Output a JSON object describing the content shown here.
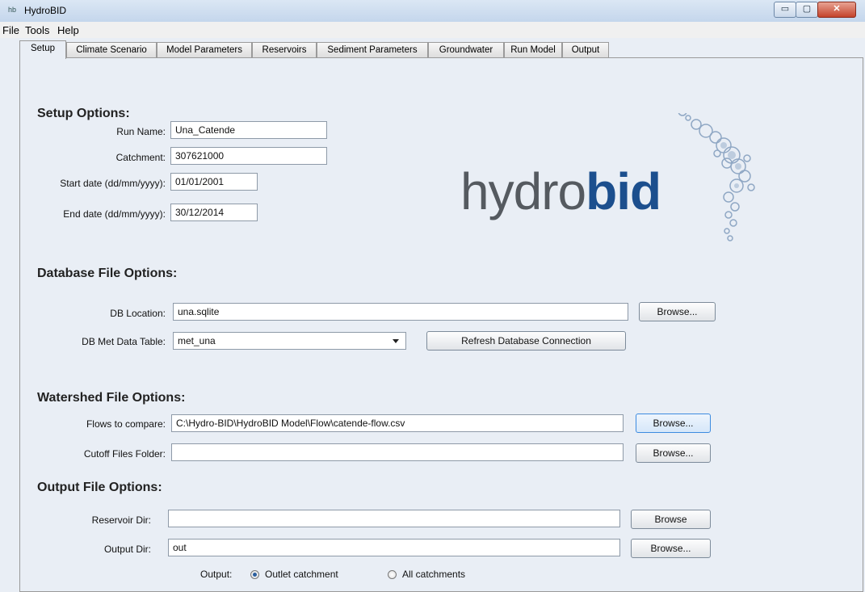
{
  "window": {
    "app_icon": "hb",
    "title": "HydroBID",
    "minimize": "▭",
    "maximize": "▢",
    "close": "✕"
  },
  "menu": [
    "File",
    "Tools",
    "Help"
  ],
  "tabs": [
    "Setup",
    "Climate Scenario",
    "Model Parameters",
    "Reservoirs",
    "Sediment Parameters",
    "Groundwater",
    "Run Model",
    "Output"
  ],
  "active_tab": "Setup",
  "setup": {
    "heading": "Setup Options:",
    "run_name_label": "Run Name:",
    "run_name": "Una_Catende",
    "catchment_label": "Catchment:",
    "catchment": "307621000",
    "start_label": "Start date (dd/mm/yyyy):",
    "start_date": "01/01/2001",
    "end_label": "End date (dd/mm/yyyy):",
    "end_date": "30/12/2014"
  },
  "logo": {
    "hydro": "hydro",
    "bid": "bid"
  },
  "database": {
    "heading": "Database File Options:",
    "location_label": "DB Location:",
    "location": "una.sqlite",
    "browse": "Browse...",
    "table_label": "DB Met Data Table:",
    "table": "met_una",
    "refresh": "Refresh Database Connection"
  },
  "watershed": {
    "heading": "Watershed File Options:",
    "flows_label": "Flows to compare:",
    "flows": "C:\\Hydro-BID\\HydroBID Model\\Flow\\catende-flow.csv",
    "browse_flows": "Browse...",
    "cutoff_label": "Cutoff Files Folder:",
    "cutoff": "",
    "browse_cutoff": "Browse..."
  },
  "output": {
    "heading": "Output File Options:",
    "reservoir_label": "Reservoir Dir:",
    "reservoir": "",
    "browse_reservoir": "Browse",
    "output_label": "Output Dir:",
    "output_dir": "out",
    "browse_output": "Browse...",
    "mode_label": "Output:",
    "options": [
      "Outlet catchment",
      "All catchments"
    ],
    "selected": "Outlet catchment"
  },
  "colors": {
    "brand_blue": "#1c4f8e",
    "brand_gray": "#555a60",
    "focus": "#3d8be0"
  }
}
